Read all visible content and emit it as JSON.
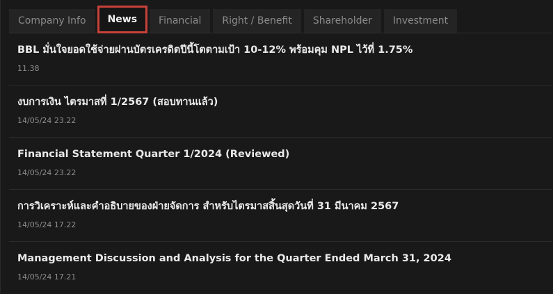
{
  "tabs": [
    {
      "label": "Company Info"
    },
    {
      "label": "News"
    },
    {
      "label": "Financial"
    },
    {
      "label": "Right / Benefit"
    },
    {
      "label": "Shareholder"
    },
    {
      "label": "Investment"
    }
  ],
  "active_tab": "News",
  "news": [
    {
      "headline": "BBL มั่นใจยอดใช้จ่ายผ่านบัตรเครดิตปีนี้โตตามเป้า 10-12% พร้อมคุม NPL ไว้ที่ 1.75%",
      "time": "11.38"
    },
    {
      "headline": "งบการเงิน ไตรมาสที่ 1/2567 (สอบทานแล้ว)",
      "time": "14/05/24 23.22"
    },
    {
      "headline": "Financial Statement Quarter 1/2024 (Reviewed)",
      "time": "14/05/24 23.22"
    },
    {
      "headline": "การวิเคราะห์และคำอธิบายของฝ่ายจัดการ สำหรับไตรมาสสิ้นสุดวันที่ 31 มีนาคม 2567",
      "time": "14/05/24 17.22"
    },
    {
      "headline": "Management Discussion and Analysis for the Quarter Ended March 31, 2024",
      "time": "14/05/24 17.21"
    }
  ],
  "colors": {
    "background": "#191919",
    "tab_bg": "#242424",
    "active_outline": "#c9413a",
    "headline": "#eaeaea",
    "timestamp": "#8d8d8d"
  }
}
